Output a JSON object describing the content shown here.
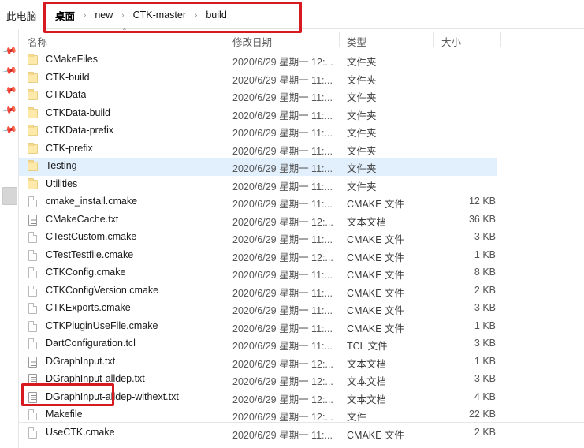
{
  "window": {
    "this_pc_label": "此电脑"
  },
  "breadcrumb": {
    "separator": "›",
    "items": [
      "桌面",
      "new",
      "CTK-master",
      "build"
    ]
  },
  "columns": {
    "name": "名称",
    "date": "修改日期",
    "type": "类型",
    "size": "大小"
  },
  "annotations": {
    "highlight_color": "#d71920",
    "boxes": [
      "breadcrumb-path",
      "makefile-row"
    ]
  },
  "selection": {
    "selected_row": "Testing",
    "selection_color": "#e2effc"
  },
  "sidebar": {
    "pin_icon": "pin-icon",
    "pin_count": 5
  },
  "files": [
    {
      "name": "CMakeFiles",
      "date": "2020/6/29 星期一 12:...",
      "type": "文件夹",
      "size": "",
      "icon": "folder"
    },
    {
      "name": "CTK-build",
      "date": "2020/6/29 星期一 11:...",
      "type": "文件夹",
      "size": "",
      "icon": "folder"
    },
    {
      "name": "CTKData",
      "date": "2020/6/29 星期一 11:...",
      "type": "文件夹",
      "size": "",
      "icon": "folder"
    },
    {
      "name": "CTKData-build",
      "date": "2020/6/29 星期一 11:...",
      "type": "文件夹",
      "size": "",
      "icon": "folder"
    },
    {
      "name": "CTKData-prefix",
      "date": "2020/6/29 星期一 11:...",
      "type": "文件夹",
      "size": "",
      "icon": "folder"
    },
    {
      "name": "CTK-prefix",
      "date": "2020/6/29 星期一 11:...",
      "type": "文件夹",
      "size": "",
      "icon": "folder"
    },
    {
      "name": "Testing",
      "date": "2020/6/29 星期一 11:...",
      "type": "文件夹",
      "size": "",
      "icon": "folder",
      "selected": true
    },
    {
      "name": "Utilities",
      "date": "2020/6/29 星期一 11:...",
      "type": "文件夹",
      "size": "",
      "icon": "folder"
    },
    {
      "name": "cmake_install.cmake",
      "date": "2020/6/29 星期一 11:...",
      "type": "CMAKE 文件",
      "size": "12 KB",
      "icon": "file"
    },
    {
      "name": "CMakeCache.txt",
      "date": "2020/6/29 星期一 12:...",
      "type": "文本文档",
      "size": "36 KB",
      "icon": "text"
    },
    {
      "name": "CTestCustom.cmake",
      "date": "2020/6/29 星期一 11:...",
      "type": "CMAKE 文件",
      "size": "3 KB",
      "icon": "file"
    },
    {
      "name": "CTestTestfile.cmake",
      "date": "2020/6/29 星期一 12:...",
      "type": "CMAKE 文件",
      "size": "1 KB",
      "icon": "file"
    },
    {
      "name": "CTKConfig.cmake",
      "date": "2020/6/29 星期一 11:...",
      "type": "CMAKE 文件",
      "size": "8 KB",
      "icon": "file"
    },
    {
      "name": "CTKConfigVersion.cmake",
      "date": "2020/6/29 星期一 11:...",
      "type": "CMAKE 文件",
      "size": "2 KB",
      "icon": "file"
    },
    {
      "name": "CTKExports.cmake",
      "date": "2020/6/29 星期一 11:...",
      "type": "CMAKE 文件",
      "size": "3 KB",
      "icon": "file"
    },
    {
      "name": "CTKPluginUseFile.cmake",
      "date": "2020/6/29 星期一 11:...",
      "type": "CMAKE 文件",
      "size": "1 KB",
      "icon": "file"
    },
    {
      "name": "DartConfiguration.tcl",
      "date": "2020/6/29 星期一 11:...",
      "type": "TCL 文件",
      "size": "3 KB",
      "icon": "file"
    },
    {
      "name": "DGraphInput.txt",
      "date": "2020/6/29 星期一 12:...",
      "type": "文本文档",
      "size": "1 KB",
      "icon": "text"
    },
    {
      "name": "DGraphInput-alldep.txt",
      "date": "2020/6/29 星期一 12:...",
      "type": "文本文档",
      "size": "3 KB",
      "icon": "text"
    },
    {
      "name": "DGraphInput-alldep-withext.txt",
      "date": "2020/6/29 星期一 12:...",
      "type": "文本文档",
      "size": "4 KB",
      "icon": "text"
    },
    {
      "name": "Makefile",
      "date": "2020/6/29 星期一 12:...",
      "type": "文件",
      "size": "22 KB",
      "icon": "file",
      "annotated": true
    },
    {
      "name": "UseCTK.cmake",
      "date": "2020/6/29 星期一 11:...",
      "type": "CMAKE 文件",
      "size": "2 KB",
      "icon": "file"
    }
  ]
}
